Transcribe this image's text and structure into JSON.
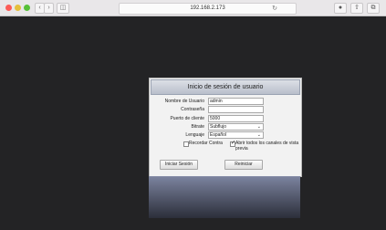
{
  "browser": {
    "address": "192.168.2.173",
    "nav_back": "‹",
    "nav_forward": "›",
    "sidebar_glyph": "◫",
    "reload_glyph": "↻",
    "info_glyph": "●",
    "share_glyph": "⇧",
    "tabs_glyph": "⧉"
  },
  "login": {
    "title": "Inicio de sesión de usuario",
    "fields": [
      {
        "label": "Nombre de Usuario",
        "value": "admin"
      },
      {
        "label": "Contraseña",
        "value": ""
      },
      {
        "label": "Puerto de cliente",
        "value": "5000"
      }
    ],
    "selects": [
      {
        "label": "Bitrate",
        "value": "Subflujo"
      },
      {
        "label": "Lenguaje",
        "value": "Español"
      }
    ],
    "remember_label": "Recordar Contra",
    "remember_checked": false,
    "open_all_label_1": "Abrir todos los canales de vista",
    "open_all_label_2": "previa",
    "open_all_checked": true,
    "login_button": "Iniciar Sesión",
    "reset_button": "Reiniciar"
  },
  "colors": {
    "background": "#232325",
    "panel": "#f2f2f2",
    "title_bar": "#c4c9d4"
  }
}
